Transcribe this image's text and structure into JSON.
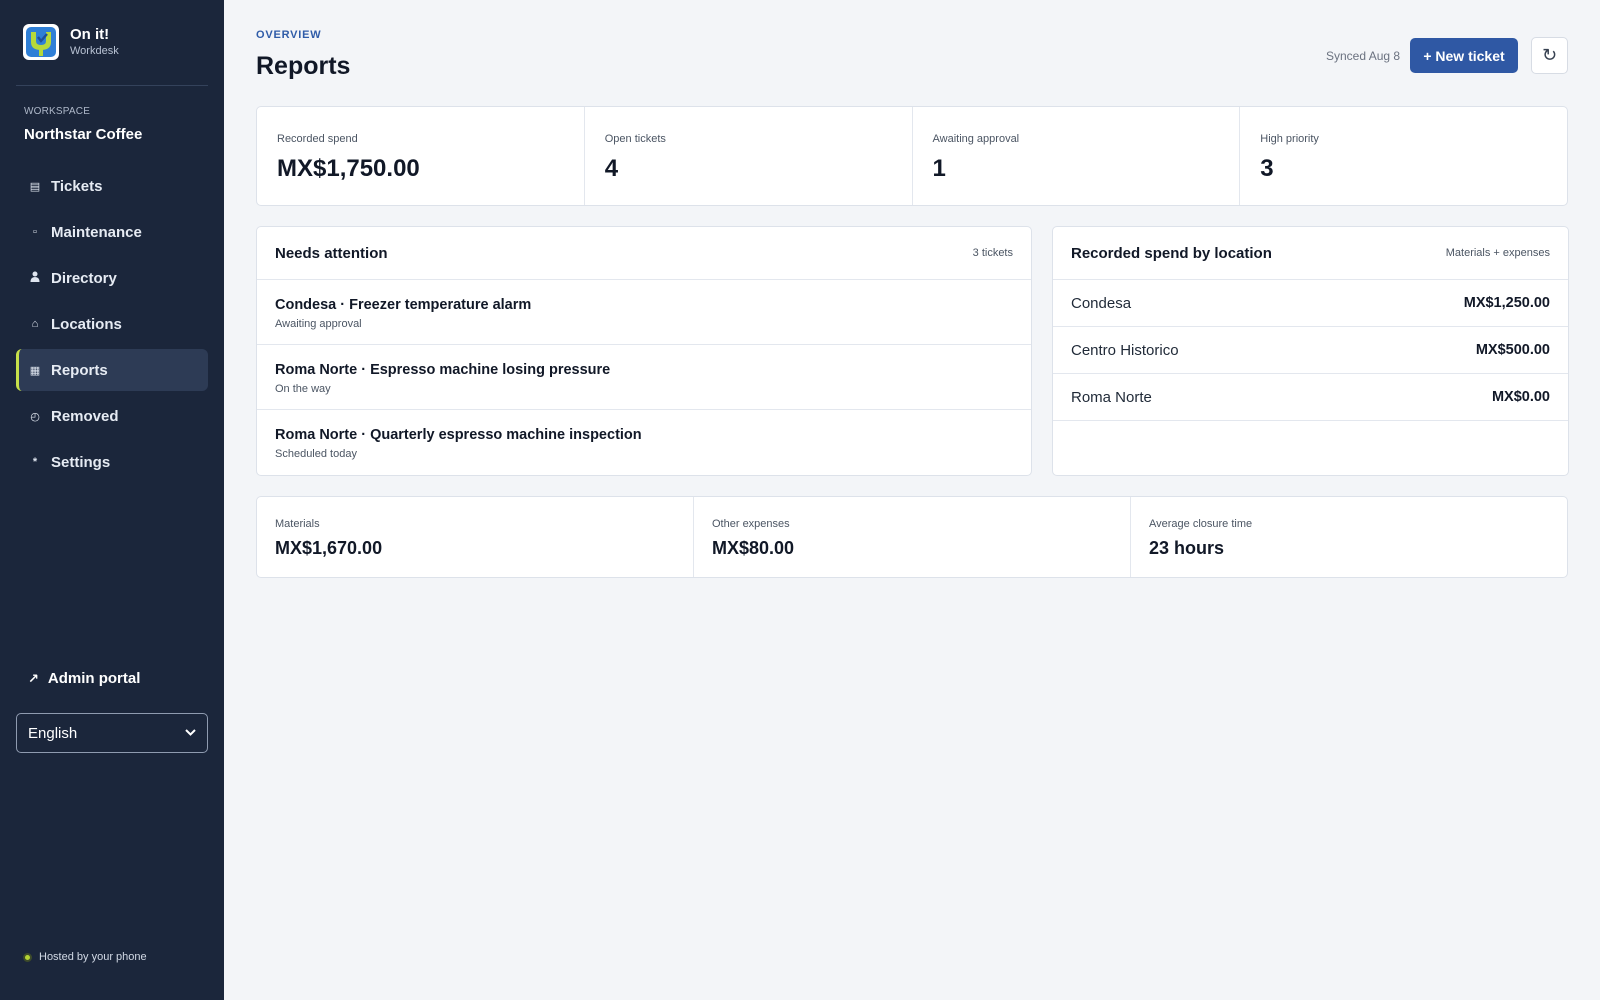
{
  "brand": {
    "name": "On it!",
    "subtitle": "Workdesk"
  },
  "workspace": {
    "label": "WORKSPACE",
    "name": "Northstar Coffee"
  },
  "nav": [
    {
      "label": "Tickets",
      "icon": "list-icon",
      "glyph": "▤",
      "active": false
    },
    {
      "label": "Maintenance",
      "icon": "square-icon",
      "glyph": "▫",
      "active": false
    },
    {
      "label": "Directory",
      "icon": "person-icon",
      "glyph": "👤",
      "active": false
    },
    {
      "label": "Locations",
      "icon": "home-icon",
      "glyph": "⌂",
      "active": false
    },
    {
      "label": "Reports",
      "icon": "chart-icon",
      "glyph": "▦",
      "active": true
    },
    {
      "label": "Removed",
      "icon": "clock-icon",
      "glyph": "◴",
      "active": false
    },
    {
      "label": "Settings",
      "icon": "asterisk-icon",
      "glyph": "*",
      "active": false
    }
  ],
  "admin_portal": {
    "label": "Admin portal",
    "glyph": "↗"
  },
  "language": {
    "selected": "English"
  },
  "hosted": "Hosted by your phone",
  "header": {
    "eyebrow": "OVERVIEW",
    "title": "Reports",
    "synced": "Synced Aug 8",
    "new_ticket": "+ New ticket",
    "refresh_glyph": "↻"
  },
  "stats": [
    {
      "label": "Recorded spend",
      "value": "MX$1,750.00"
    },
    {
      "label": "Open tickets",
      "value": "4"
    },
    {
      "label": "Awaiting approval",
      "value": "1"
    },
    {
      "label": "High priority",
      "value": "3"
    }
  ],
  "attention": {
    "title": "Needs attention",
    "count": "3 tickets",
    "items": [
      {
        "title": "Condesa · Freezer temperature alarm",
        "status": "Awaiting approval"
      },
      {
        "title": "Roma Norte · Espresso machine losing pressure",
        "status": "On the way"
      },
      {
        "title": "Roma Norte · Quarterly espresso machine inspection",
        "status": "Scheduled today"
      }
    ]
  },
  "spend_by_location": {
    "title": "Recorded spend by location",
    "meta": "Materials + expenses",
    "rows": [
      {
        "location": "Condesa",
        "amount": "MX$1,250.00"
      },
      {
        "location": "Centro Historico",
        "amount": "MX$500.00"
      },
      {
        "location": "Roma Norte",
        "amount": "MX$0.00"
      }
    ]
  },
  "bottom_stats": [
    {
      "label": "Materials",
      "value": "MX$1,670.00"
    },
    {
      "label": "Other expenses",
      "value": "MX$80.00"
    },
    {
      "label": "Average closure time",
      "value": "23 hours"
    }
  ],
  "colors": {
    "sidebar": "#1b263b",
    "accent": "#2f58a4",
    "active_marker": "#c7e04a",
    "background": "#f3f5f8"
  }
}
